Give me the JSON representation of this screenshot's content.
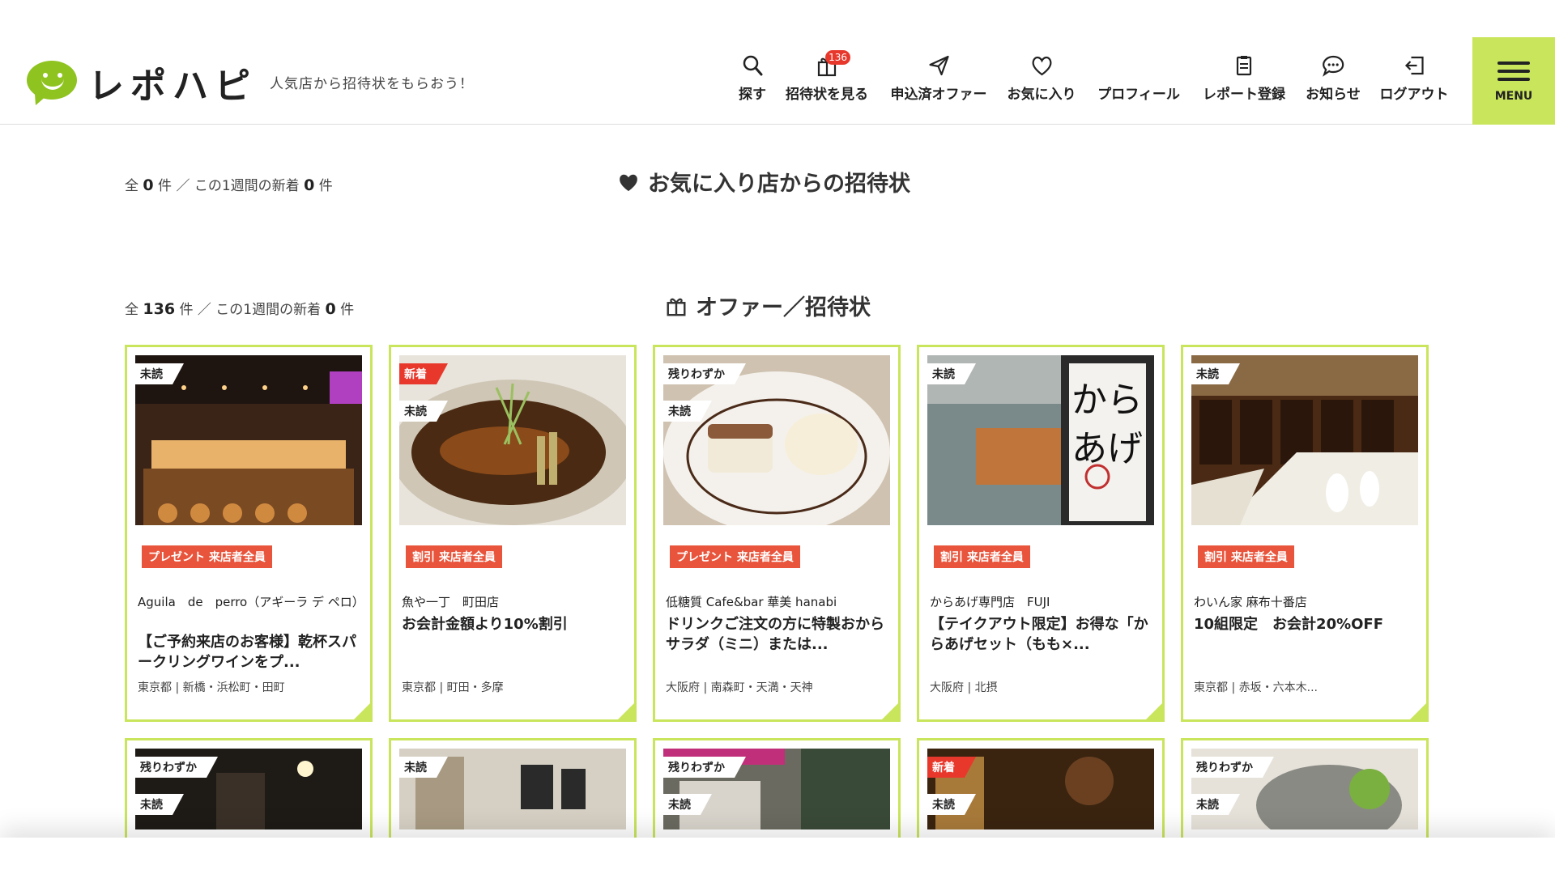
{
  "header": {
    "logo_text": "レポハピ",
    "tagline": "人気店から招待状をもらおう！",
    "nav": [
      {
        "label": "探す",
        "icon": "search-icon"
      },
      {
        "label": "招待状を見る",
        "icon": "gift-icon",
        "badge": "136"
      },
      {
        "label": "申込済オファー",
        "icon": "paper-plane-icon"
      },
      {
        "label": "お気に入り",
        "icon": "heart-icon"
      },
      {
        "label": "プロフィール",
        "icon": "user-icon"
      },
      {
        "label": "レポート登録",
        "icon": "clipboard-icon"
      },
      {
        "label": "お知らせ",
        "icon": "chat-icon"
      },
      {
        "label": "ログアウト",
        "icon": "logout-icon"
      }
    ],
    "menu_label": "MENU"
  },
  "favorites": {
    "count_text_1": "全",
    "total": "0",
    "count_text_2": "件 ／ この1週間の新着",
    "new": "0",
    "count_text_3": "件",
    "title": "お気に入り店からの招待状"
  },
  "offers": {
    "count_text_1": "全",
    "total": "136",
    "count_text_2": "件 ／ この1週間の新着",
    "new": "0",
    "count_text_3": "件",
    "title": "オファー／招待状"
  },
  "cards": [
    {
      "tags": [
        "未読"
      ],
      "category": "プレゼント 来店者全員",
      "shop": "Aguila　de　perro（アギーラ デ ペロ）",
      "offer": "【ご予約来店のお客様】乾杯スパークリングワインをプ...",
      "area": "東京都 | 新橋・浜松町・田町"
    },
    {
      "tags": [
        "新着",
        "未読"
      ],
      "category": "割引 来店者全員",
      "shop": "魚や一丁　町田店",
      "offer": "お会計金額より10%割引",
      "area": "東京都 | 町田・多摩"
    },
    {
      "tags": [
        "残りわずか",
        "未読"
      ],
      "category": "プレゼント 来店者全員",
      "shop": "低糖質 Cafe&bar 華美 hanabi",
      "offer": "ドリンクご注文の方に特製おからサラダ（ミニ）または...",
      "area": "大阪府 | 南森町・天満・天神"
    },
    {
      "tags": [
        "未読"
      ],
      "category": "割引 来店者全員",
      "shop": "からあげ専門店　FUJI",
      "offer": "【テイクアウト限定】お得な「からあげセット（もも×...",
      "area": "大阪府 | 北摂"
    },
    {
      "tags": [
        "未読"
      ],
      "category": "割引 来店者全員",
      "shop": "わいん家 麻布十番店",
      "offer": "10組限定　お会計20%OFF",
      "area": "東京都 | 赤坂・六本木..."
    }
  ],
  "cards_row2": [
    {
      "tags": [
        "残りわずか",
        "未読"
      ]
    },
    {
      "tags": [
        "未読"
      ]
    },
    {
      "tags": [
        "残りわずか",
        "未読"
      ]
    },
    {
      "tags": [
        "新着",
        "未読"
      ]
    },
    {
      "tags": [
        "残りわずか",
        "未読"
      ]
    }
  ],
  "colors": {
    "accent": "#c9e55c",
    "logo": "#8fc31f",
    "badge": "#e8382c",
    "category": "#e8553c"
  }
}
